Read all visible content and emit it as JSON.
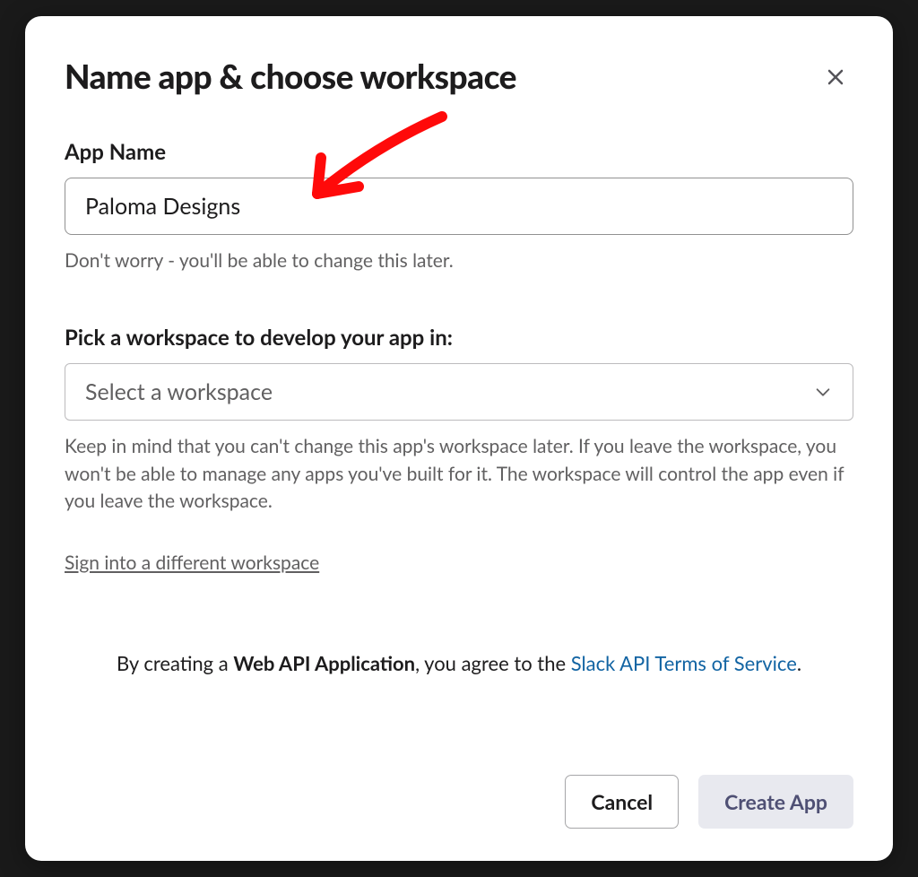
{
  "modal": {
    "title": "Name app & choose workspace",
    "close_label": "Close"
  },
  "app_name": {
    "label": "App Name",
    "value": "Paloma Designs",
    "helper": "Don't worry - you'll be able to change this later."
  },
  "workspace": {
    "label": "Pick a workspace to develop your app in:",
    "placeholder": "Select a workspace",
    "helper": "Keep in mind that you can't change this app's workspace later. If you leave the workspace, you won't be able to manage any apps you've built for it. The workspace will control the app even if you leave the workspace."
  },
  "links": {
    "sign_in_different": "Sign into a different workspace"
  },
  "terms": {
    "prefix": "By creating a ",
    "bold": "Web API Application",
    "middle": ", you agree to the ",
    "link": "Slack API Terms of Service",
    "suffix": "."
  },
  "footer": {
    "cancel": "Cancel",
    "create": "Create App"
  },
  "annotation": {
    "type": "arrow",
    "color": "#ff0000",
    "target": "app-name-input"
  }
}
